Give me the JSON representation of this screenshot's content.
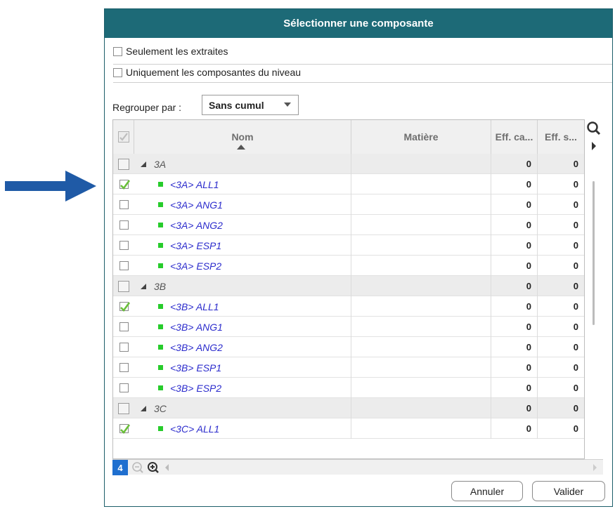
{
  "dialog": {
    "title": "Sélectionner une composante",
    "options": [
      {
        "label": "Seulement les extraites",
        "checked": false
      },
      {
        "label": "Uniquement les composantes du niveau",
        "checked": false
      }
    ],
    "group_by": {
      "label": "Regrouper par :",
      "value": "Sans cumul"
    },
    "columns": [
      "Nom",
      "Matière",
      "Eff. ca...",
      "Eff. s..."
    ],
    "rows": [
      {
        "type": "group",
        "name": "3A",
        "matiere": "",
        "eff_ca": "0",
        "eff_s": "0",
        "checked": false
      },
      {
        "type": "item",
        "name": "<3A> ALL1",
        "matiere": "",
        "eff_ca": "0",
        "eff_s": "0",
        "checked": true
      },
      {
        "type": "item",
        "name": "<3A> ANG1",
        "matiere": "",
        "eff_ca": "0",
        "eff_s": "0",
        "checked": false
      },
      {
        "type": "item",
        "name": "<3A> ANG2",
        "matiere": "",
        "eff_ca": "0",
        "eff_s": "0",
        "checked": false
      },
      {
        "type": "item",
        "name": "<3A> ESP1",
        "matiere": "",
        "eff_ca": "0",
        "eff_s": "0",
        "checked": false
      },
      {
        "type": "item",
        "name": "<3A> ESP2",
        "matiere": "",
        "eff_ca": "0",
        "eff_s": "0",
        "checked": false
      },
      {
        "type": "group",
        "name": "3B",
        "matiere": "",
        "eff_ca": "0",
        "eff_s": "0",
        "checked": false
      },
      {
        "type": "item",
        "name": "<3B> ALL1",
        "matiere": "",
        "eff_ca": "0",
        "eff_s": "0",
        "checked": true
      },
      {
        "type": "item",
        "name": "<3B> ANG1",
        "matiere": "",
        "eff_ca": "0",
        "eff_s": "0",
        "checked": false
      },
      {
        "type": "item",
        "name": "<3B> ANG2",
        "matiere": "",
        "eff_ca": "0",
        "eff_s": "0",
        "checked": false
      },
      {
        "type": "item",
        "name": "<3B> ESP1",
        "matiere": "",
        "eff_ca": "0",
        "eff_s": "0",
        "checked": false
      },
      {
        "type": "item",
        "name": "<3B> ESP2",
        "matiere": "",
        "eff_ca": "0",
        "eff_s": "0",
        "checked": false
      },
      {
        "type": "group",
        "name": "3C",
        "matiere": "",
        "eff_ca": "0",
        "eff_s": "0",
        "checked": false
      },
      {
        "type": "item",
        "name": "<3C> ALL1",
        "matiere": "",
        "eff_ca": "0",
        "eff_s": "0",
        "checked": true
      }
    ],
    "count": "4",
    "buttons": {
      "cancel": "Annuler",
      "ok": "Valider"
    },
    "colors": {
      "title_bar": "#1d6a77",
      "item_text": "#2b2bcc",
      "item_marker": "#27cc2b",
      "check": "#6abf3a",
      "badge": "#1f6fcf",
      "arrow": "#1f5aa6"
    }
  }
}
